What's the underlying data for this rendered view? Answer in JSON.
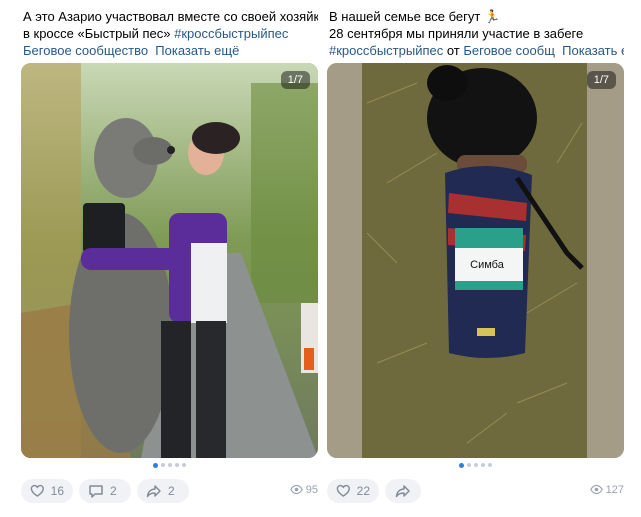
{
  "posts": [
    {
      "text_line1": "А это Азарио участвовал вместе со своей хозяйкой",
      "text_line2_prefix": "в кроссе «Быстрый пес» ",
      "hashtag": "#кроссбыстрыйпес",
      "group_link": "Беговое сообщество",
      "show_more": "Показать ещё",
      "photo_counter": "1/7",
      "likes": "16",
      "comments": "2",
      "shares": "2",
      "views": "95"
    },
    {
      "text_line1": "В нашей семье все бегут",
      "text_line2": "28 сентября мы приняли участие в забеге",
      "hashtag": "#кроссбыстрыйпес",
      "from_label": " от ",
      "group_link": "Беговое сообщ",
      "show_more": "Показать ещё",
      "photo_counter": "1/7",
      "likes": "22",
      "views": "127",
      "bib_text": "Симба"
    }
  ]
}
